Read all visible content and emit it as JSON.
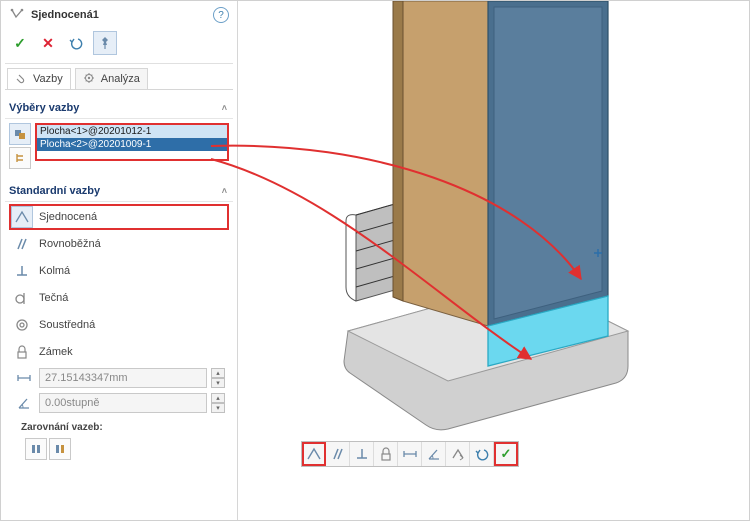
{
  "header": {
    "title": "Sjednocená1"
  },
  "tabs": {
    "mates": "Vazby",
    "analysis": "Analýza"
  },
  "sections": {
    "selections": "Výběry vazby",
    "standard": "Standardní vazby",
    "alignment": "Zarovnání vazeb:"
  },
  "selections": {
    "items": [
      "Plocha<1>@20201012-1",
      "Plocha<2>@20201009-1"
    ]
  },
  "mates": {
    "coincident": "Sjednocená",
    "parallel": "Rovnoběžná",
    "perp": "Kolmá",
    "tangent": "Tečná",
    "concentric": "Soustředná",
    "lock": "Zámek"
  },
  "dims": {
    "distance": "27.15143347mm",
    "angle": "0.00stupně"
  },
  "colors": {
    "highlight": "#e03030"
  }
}
